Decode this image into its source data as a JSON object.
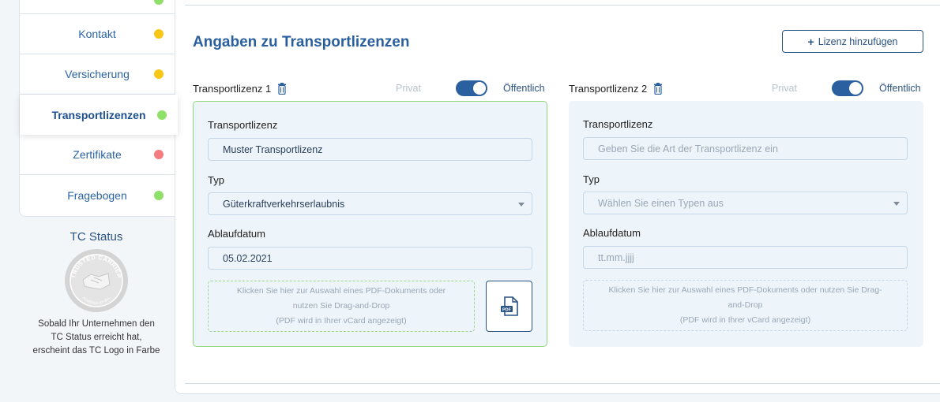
{
  "sidebar": {
    "items": [
      {
        "label": "",
        "status": "#8ee06a"
      },
      {
        "label": "Kontakt",
        "status": "#f8c716"
      },
      {
        "label": "Versicherung",
        "status": "#f8c716"
      },
      {
        "label": "Transportlizenzen",
        "status": "#8ee06a",
        "active": true
      },
      {
        "label": "Zertifikate",
        "status": "#f47b80"
      },
      {
        "label": "Fragebogen",
        "status": "#8ee06a"
      }
    ]
  },
  "tc_status": {
    "title": "TC Status",
    "logo_text_top": "TRUSTED CARRIER",
    "logo_text_bottom": "POWERED BY BVL",
    "text_line1": "Sobald Ihr Unternehmen den",
    "text_line2": "TC Status erreicht hat,",
    "text_line3": "erscheint das TC Logo in Farbe"
  },
  "main": {
    "heading": "Angaben zu Transportlizenzen",
    "add_button": "Lizenz hinzufügen"
  },
  "licenses": [
    {
      "name": "Transportlizenz 1",
      "privat": "Privat",
      "oeffentlich": "Öffentlich",
      "lizenz_label": "Transportlizenz",
      "lizenz_value": "Muster Transportlizenz",
      "typ_label": "Typ",
      "typ_value": "Güterkraftverkehrserlaubnis",
      "datum_label": "Ablaufdatum",
      "datum_value": "05.02.2021",
      "drop_line1": "Klicken Sie hier zur Auswahl eines PDF-Dokuments oder",
      "drop_line2": "nutzen Sie Drag-and-Drop",
      "drop_line3": "(PDF wird in Ihrer vCard angezeigt)",
      "pdf_icon_text": "PDF"
    },
    {
      "name": "Transportlizenz 2",
      "privat": "Privat",
      "oeffentlich": "Öffentlich",
      "lizenz_label": "Transportlizenz",
      "lizenz_placeholder": "Geben Sie die Art der Transportlizenz ein",
      "typ_label": "Typ",
      "typ_placeholder": "Wählen Sie einen Typen aus",
      "datum_label": "Ablaufdatum",
      "datum_placeholder": "tt.mm.jjjj",
      "drop_line1": "Klicken Sie hier zur Auswahl eines PDF-Dokuments oder nutzen Sie Drag-",
      "drop_line2": "and-Drop",
      "drop_line3": "(PDF wird in Ihrer vCard angezeigt)"
    }
  ],
  "icons": {
    "trash": "trash-icon",
    "plus": "plus-icon",
    "pdf": "pdf-upload-icon",
    "caret": "caret-down-icon"
  },
  "colors": {
    "accent": "#2a5fa0",
    "green": "#8ee06a",
    "yellow": "#f8c716",
    "red": "#f47b80"
  }
}
